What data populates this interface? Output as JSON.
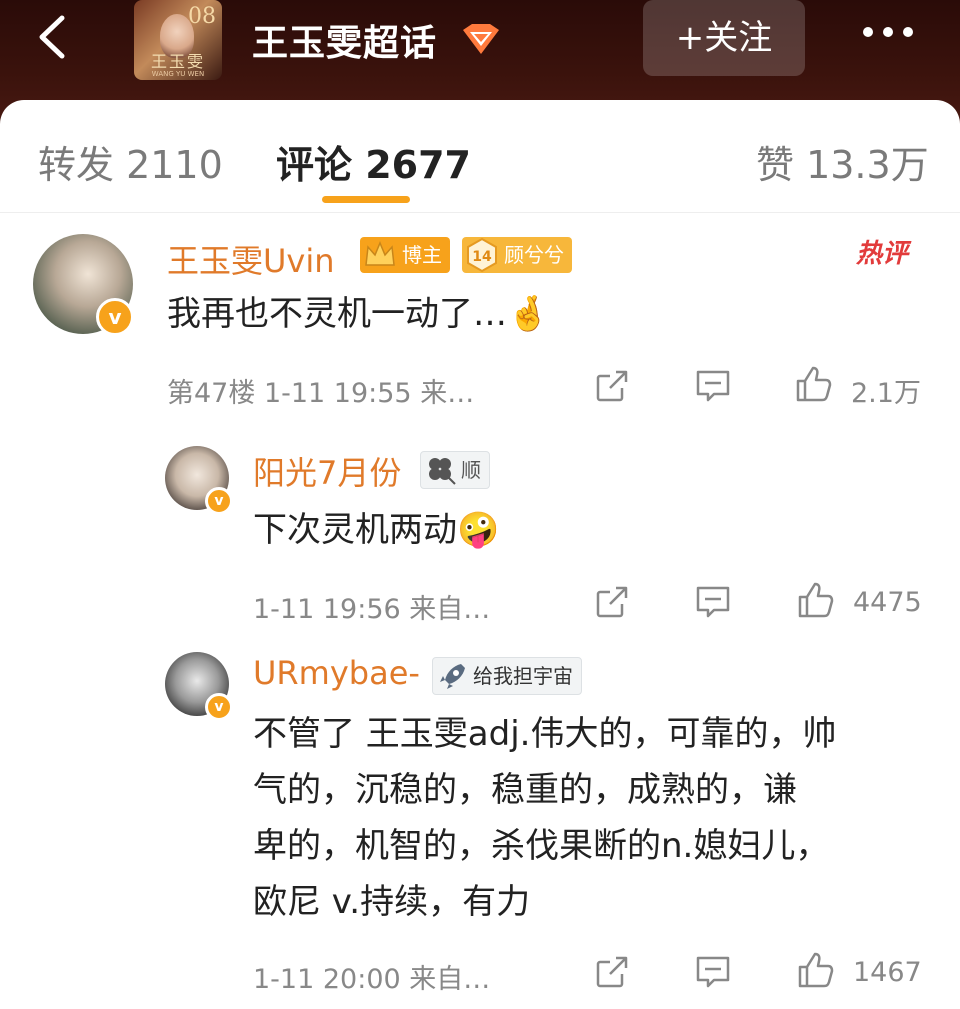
{
  "header": {
    "title": "王玉雯超话",
    "follow_label": "+关注",
    "cover": {
      "text": "王玉雯",
      "mark": "08",
      "sub": "WANG YU WEN"
    }
  },
  "tabs": [
    {
      "label": "转发 2110"
    },
    {
      "label": "评论 2677"
    },
    {
      "label": "赞 13.3万"
    }
  ],
  "comments": [
    {
      "name": "王玉雯Uvin",
      "badges": [
        "博主",
        "顾兮兮"
      ],
      "level": "14",
      "hot": "热评",
      "text": "我再也不灵机一动了…🤞",
      "meta": "第47楼 1-11 19:55 来…",
      "likes": "2.1万"
    },
    {
      "name": "阳光7月份",
      "badges": [
        "顺"
      ],
      "text": "下次灵机两动🤪",
      "meta": "1-11 19:56 来自…",
      "likes": "4475"
    },
    {
      "name": "URmybae-",
      "badges": [
        "给我担宇宙"
      ],
      "text_lines": [
        "不管了 王玉雯adj.伟大的，可靠的，帅",
        "气的，沉稳的，稳重的，成熟的，谦",
        "卑的，机智的，杀伐果断的n.媳妇儿，",
        "欧尼 v.持续，有力"
      ],
      "meta": "1-11 20:00 来自…",
      "likes": "1467"
    }
  ],
  "colors": {
    "accent": "#f7a21b",
    "name": "#e07a2a",
    "hot": "#e23b3b",
    "topbar": "#3a120c"
  }
}
